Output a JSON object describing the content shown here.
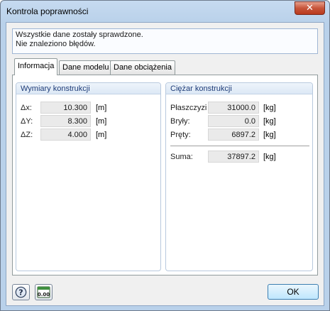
{
  "window": {
    "title": "Kontrola poprawności",
    "close_glyph": "✕"
  },
  "message": {
    "line1": "Wszystkie dane zostały sprawdzone.",
    "line2": "Nie znaleziono błędów."
  },
  "tabs": [
    {
      "label": "Informacja",
      "active": true
    },
    {
      "label": "Dane modelu",
      "active": false
    },
    {
      "label": "Dane obciążenia",
      "active": false
    }
  ],
  "dimensions": {
    "title": "Wymiary konstrukcji",
    "rows": [
      {
        "label": "Δx:",
        "value": "10.300",
        "unit": "[m]"
      },
      {
        "label": "ΔY:",
        "value": "8.300",
        "unit": "[m]"
      },
      {
        "label": "ΔZ:",
        "value": "4.000",
        "unit": "[m]"
      }
    ]
  },
  "weight": {
    "title": "Ciężar konstrukcji",
    "rows": [
      {
        "label": "Płaszczyzi",
        "value": "31000.0",
        "unit": "[kg]"
      },
      {
        "label": "Bryły:",
        "value": "0.0",
        "unit": "[kg]"
      },
      {
        "label": "Pręty:",
        "value": "6897.2",
        "unit": "[kg]"
      }
    ],
    "sum": {
      "label": "Suma:",
      "value": "37897.2",
      "unit": "[kg]"
    }
  },
  "footer": {
    "help_icon": "help-icon",
    "units_icon": "units-icon",
    "units_text": "0.00",
    "ok_label": "OK"
  }
}
